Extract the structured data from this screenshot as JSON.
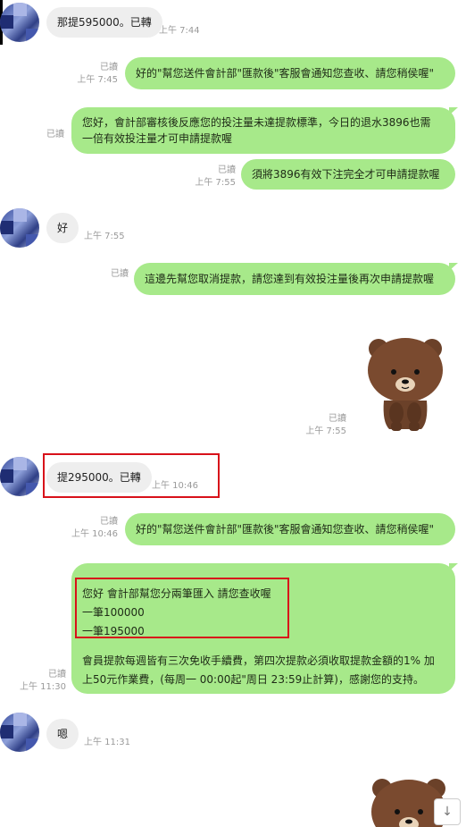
{
  "read_label": "已讀",
  "messages": [
    {
      "side": "in",
      "text": "那提595000。已轉",
      "time": "上午 7:44"
    },
    {
      "side": "out",
      "text": "好的\"幫您送件會計部\"匯款後\"客服會通知您查收、請您稍侯喔\"",
      "time": "上午 7:45"
    },
    {
      "side": "out",
      "line1": "您好，會計部審核後反應您的投注量未達提款標準，今日的退水3896也需",
      "line2": "一倍有效投注量才可申請提款喔"
    },
    {
      "side": "out",
      "text": "須將3896有效下注完全才可申請提款喔",
      "time": "上午 7:55"
    },
    {
      "side": "in",
      "text": "好",
      "time": "上午 7:55"
    },
    {
      "side": "out",
      "text": "這邊先幫您取消提款，請您達到有效投注量後再次申請提款喔"
    },
    {
      "side": "out",
      "sticker": "brown-bear",
      "time": "上午 7:55"
    },
    {
      "side": "in",
      "text": "提295000。已轉",
      "time": "上午 10:46"
    },
    {
      "side": "out",
      "text": "好的\"幫您送件會計部\"匯款後\"客服會通知您查收、請您稍侯喔\"",
      "time": "上午 10:46"
    },
    {
      "side": "out",
      "line1": "您好 會計部幫您分兩筆匯入 請您查收喔",
      "line2": "一筆100000",
      "line3": "一筆195000",
      "line4": "會員提款每週皆有三次免收手續費，第四次提款必須收取提款金額的1% 加",
      "line5": "上50元作業費，(每周一 00:00起\"周日 23:59止計算)，感謝您的支持。",
      "time": "上午 11:30"
    },
    {
      "side": "in",
      "text": "嗯",
      "time": "上午 11:31"
    },
    {
      "side": "out",
      "sticker": "brown-bear"
    }
  ],
  "scroll_down_icon": "arrow-down-icon"
}
